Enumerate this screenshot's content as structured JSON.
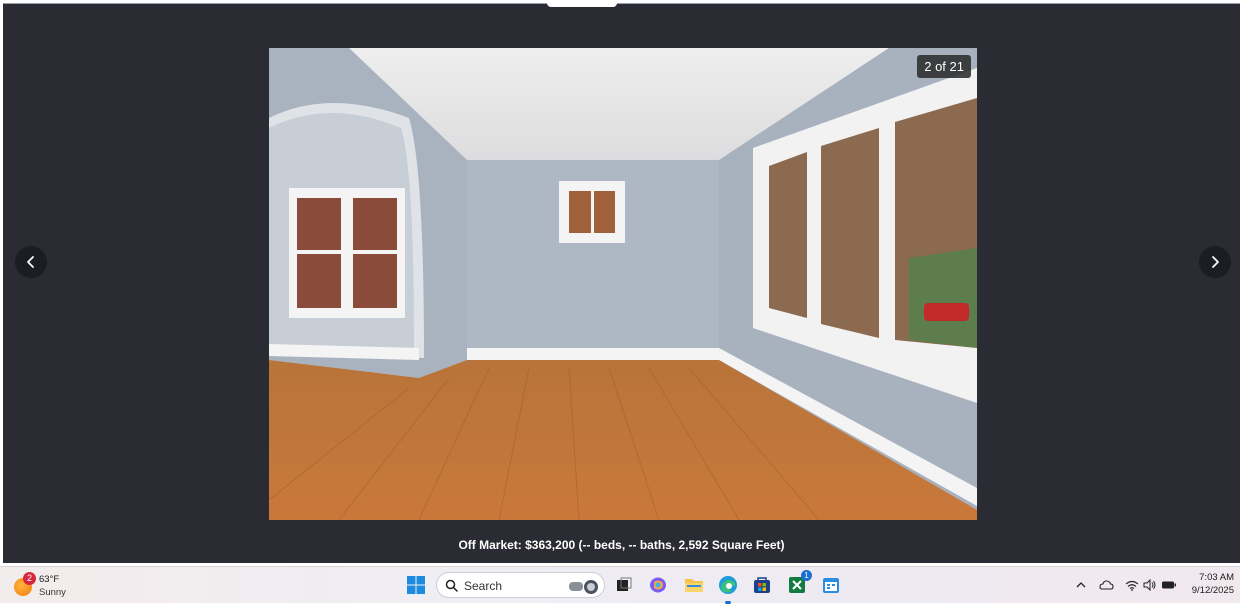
{
  "viewer": {
    "photo_counter": "2 of 21",
    "caption": "Off Market: $363,200 (-- beds, -- baths, 2,592 Square Feet)",
    "prev_icon": "chevron-left-icon",
    "next_icon": "chevron-right-icon"
  },
  "taskbar": {
    "weather": {
      "badge": "2",
      "temp": "63°F",
      "condition": "Sunny"
    },
    "search_placeholder": "Search",
    "store_badge": "1",
    "clock": {
      "time": "7:03 AM",
      "date": "9/12/2025"
    }
  },
  "colors": {
    "viewer_bg": "#2b2c33",
    "accent": "#1a6fd1",
    "badge_red": "#d7263d"
  }
}
